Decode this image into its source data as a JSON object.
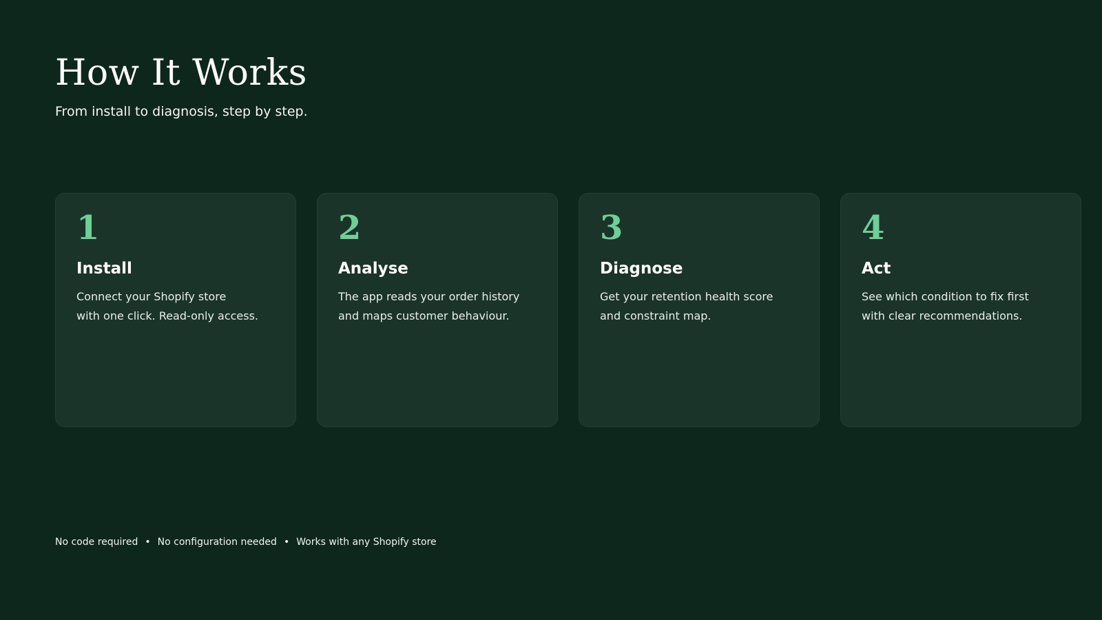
{
  "header": {
    "title": "How It Works",
    "subtitle": "From install to diagnosis, step by step."
  },
  "steps": [
    {
      "number": "1",
      "title": "Install",
      "text": "Connect your Shopify store\nwith one click. Read-only access."
    },
    {
      "number": "2",
      "title": "Analyse",
      "text": "The app reads your order history\nand maps customer behaviour."
    },
    {
      "number": "3",
      "title": "Diagnose",
      "text": "Get your retention health score\nand constraint map."
    },
    {
      "number": "4",
      "title": "Act",
      "text": "See which condition to fix first\nwith clear recommendations."
    }
  ],
  "footer": {
    "items": [
      "No code required",
      "No configuration needed",
      "Works with any Shopify store"
    ],
    "separator": "•"
  },
  "colors": {
    "background": "#0e271c",
    "card": "#1b3429",
    "accent": "#6fcf97"
  }
}
